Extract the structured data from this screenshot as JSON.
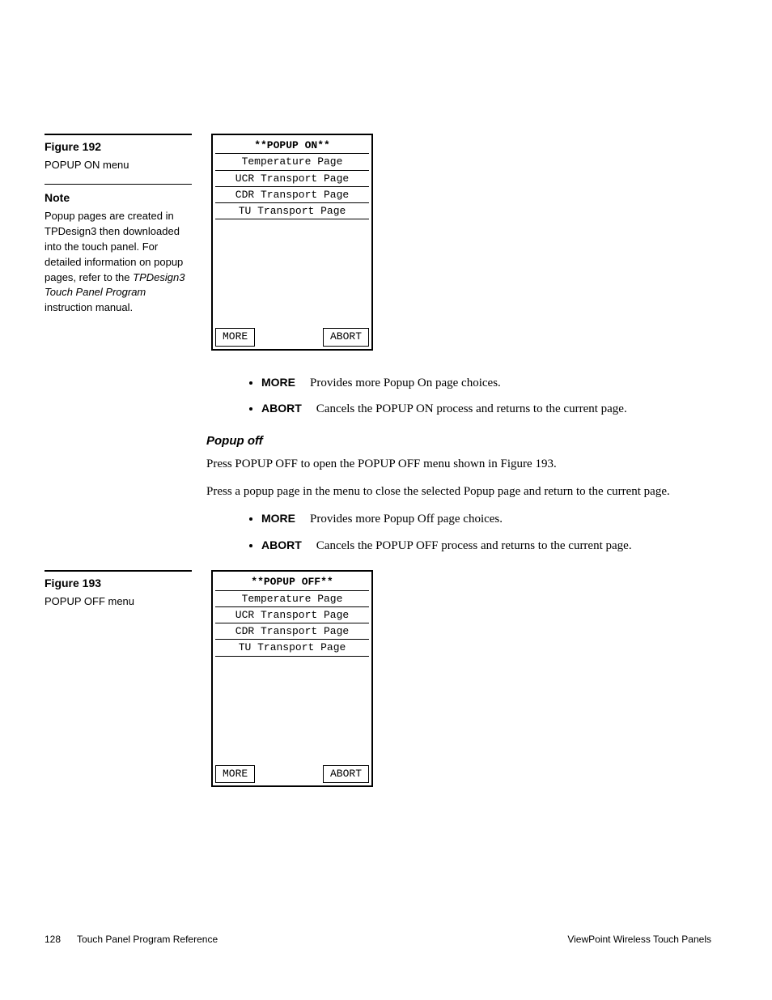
{
  "fig192": {
    "title": "Figure 192",
    "caption": "POPUP ON menu",
    "note_title": "Note",
    "note1": "Popup pages are created in TPDesign3 then downloaded into the touch panel. For detailed information on popup pages, refer to the ",
    "note_em": "TPDesign3 Touch Panel Program",
    "note2": " instruction manual."
  },
  "panel_on": {
    "title": "**POPUP ON**",
    "items": [
      "Temperature Page",
      "UCR Transport Page",
      "CDR Transport Page",
      "TU Transport Page"
    ],
    "more": "MORE",
    "abort": "ABORT"
  },
  "bullets1": {
    "more_label": "MORE",
    "more_text": "Provides more Popup On page choices.",
    "abort_label": "ABORT",
    "abort_text": "Cancels the POPUP ON process and returns to the current page."
  },
  "popup_off": {
    "heading": "Popup off",
    "p1": "Press POPUP OFF to open the POPUP OFF menu shown in Figure 193.",
    "p2": "Press a popup page in the menu to close the selected Popup page and return to the current page."
  },
  "bullets2": {
    "more_label": "MORE",
    "more_text": "Provides more Popup Off page choices.",
    "abort_label": "ABORT",
    "abort_text": "Cancels the POPUP OFF process and returns to the current page."
  },
  "fig193": {
    "title": "Figure 193",
    "caption": "POPUP OFF menu"
  },
  "panel_off": {
    "title": "**POPUP OFF**",
    "items": [
      "Temperature Page",
      "UCR Transport Page",
      "CDR Transport Page",
      "TU Transport Page"
    ],
    "more": "MORE",
    "abort": "ABORT"
  },
  "footer": {
    "page": "128",
    "left": "Touch Panel Program Reference",
    "right": "ViewPoint Wireless Touch Panels"
  }
}
